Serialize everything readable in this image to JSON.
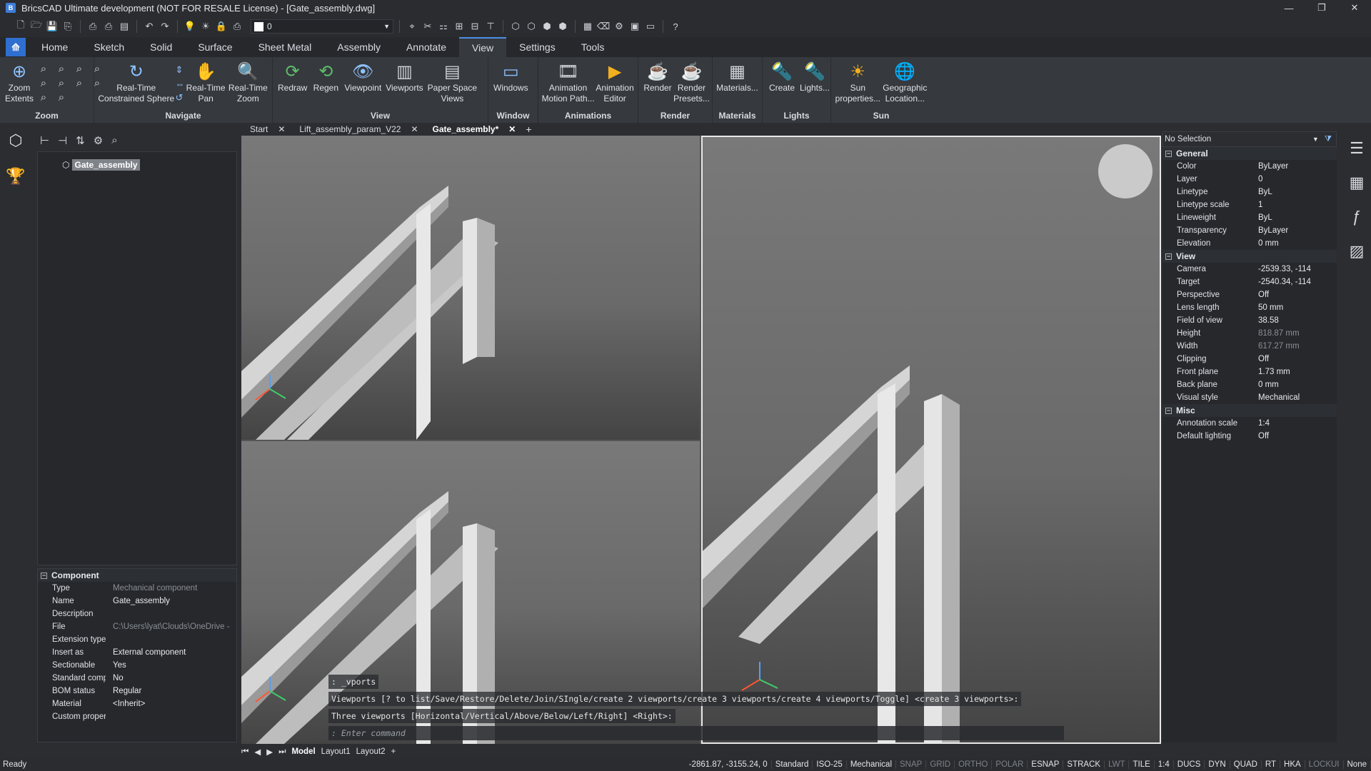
{
  "window": {
    "title": "BricsCAD Ultimate development (NOT FOR RESALE License) - [Gate_assembly.dwg]",
    "minimize": "—",
    "maximize": "❐",
    "close": "✕",
    "app_icon": "B"
  },
  "qat": {
    "layer_value": "0"
  },
  "ribbon_tabs": [
    "Home",
    "Sketch",
    "Solid",
    "Surface",
    "Sheet Metal",
    "Assembly",
    "Annotate",
    "View",
    "Settings",
    "Tools"
  ],
  "ribbon": {
    "zoom": {
      "label": "Zoom",
      "extents": "Zoom\nExtents"
    },
    "navigate": {
      "label": "Navigate",
      "sphere": "Real-Time\nConstrained Sphere",
      "pan": "Real-Time\nPan",
      "zoom": "Real-Time\nZoom"
    },
    "view": {
      "label": "View",
      "redraw": "Redraw",
      "regen": "Regen",
      "viewpoint": "Viewpoint",
      "viewports": "Viewports",
      "paper": "Paper Space\nViews"
    },
    "window": {
      "label": "Window",
      "windows": "Windows"
    },
    "animations": {
      "label": "Animations",
      "motion": "Animation\nMotion Path...",
      "editor": "Animation\nEditor"
    },
    "render": {
      "label": "Render",
      "render": "Render",
      "presets": "Render\nPresets..."
    },
    "materials": {
      "label": "Materials",
      "materials": "Materials..."
    },
    "lights": {
      "label": "Lights",
      "create": "Create",
      "lights": "Lights..."
    },
    "sun": {
      "label": "Sun",
      "props": "Sun\nproperties...",
      "geo": "Geographic\nLocation..."
    }
  },
  "browser": {
    "root": "Gate_assembly"
  },
  "component": {
    "header": "Component",
    "rows": [
      {
        "k": "Type",
        "v": "Mechanical component",
        "dim": true
      },
      {
        "k": "Name",
        "v": "Gate_assembly"
      },
      {
        "k": "Description",
        "v": ""
      },
      {
        "k": "File",
        "v": "C:\\Users\\lyat\\Clouds\\OneDrive -",
        "dim": true
      },
      {
        "k": "Extension type",
        "v": ""
      },
      {
        "k": "Insert as",
        "v": "External component"
      },
      {
        "k": "Sectionable",
        "v": "Yes"
      },
      {
        "k": "Standard compone",
        "v": "No"
      },
      {
        "k": "BOM status",
        "v": "Regular"
      },
      {
        "k": "Material",
        "v": "<Inherit>"
      },
      {
        "k": "Custom properties",
        "v": ""
      }
    ]
  },
  "doc_tabs": [
    "Start",
    "Lift_assembly_param_V22",
    "Gate_assembly*"
  ],
  "command": {
    "line1": ": _vports",
    "line2": "Viewports [? to list/Save/Restore/Delete/Join/SIngle/create 2 viewports/create 3 viewports/create 4 viewports/Toggle] <create 3 viewports>:",
    "line3": "Three viewports [Horizontal/Vertical/Above/Below/Left/Right] <Right>:",
    "placeholder": ": Enter command"
  },
  "layout_tabs": [
    "Model",
    "Layout1",
    "Layout2"
  ],
  "properties": {
    "selection": "No Selection",
    "sections": [
      {
        "title": "General",
        "rows": [
          {
            "k": "Color",
            "v": "ByLayer"
          },
          {
            "k": "Layer",
            "v": "0"
          },
          {
            "k": "Linetype",
            "v": "ByL"
          },
          {
            "k": "Linetype scale",
            "v": "1"
          },
          {
            "k": "Lineweight",
            "v": "ByL"
          },
          {
            "k": "Transparency",
            "v": "ByLayer"
          },
          {
            "k": "Elevation",
            "v": "0 mm"
          }
        ]
      },
      {
        "title": "View",
        "rows": [
          {
            "k": "Camera",
            "v": "-2539.33, -114"
          },
          {
            "k": "Target",
            "v": "-2540.34, -114"
          },
          {
            "k": "Perspective",
            "v": "Off"
          },
          {
            "k": "Lens length",
            "v": "50 mm"
          },
          {
            "k": "Field of view",
            "v": "38.58"
          },
          {
            "k": "Height",
            "v": "818.87 mm",
            "dim": true
          },
          {
            "k": "Width",
            "v": "617.27 mm",
            "dim": true
          },
          {
            "k": "Clipping",
            "v": "Off"
          },
          {
            "k": "Front plane",
            "v": "1.73 mm"
          },
          {
            "k": "Back plane",
            "v": "0 mm"
          },
          {
            "k": "Visual style",
            "v": "Mechanical"
          }
        ]
      },
      {
        "title": "Misc",
        "rows": [
          {
            "k": "Annotation scale",
            "v": "1:4"
          },
          {
            "k": "Default lighting",
            "v": "Off"
          }
        ]
      }
    ]
  },
  "status": {
    "ready": "Ready",
    "coords": "-2861.87, -3155.24, 0",
    "items": [
      "Standard",
      "ISO-25",
      "Mechanical",
      "SNAP",
      "GRID",
      "ORTHO",
      "POLAR",
      "ESNAP",
      "STRACK",
      "LWT",
      "TILE",
      "1:4",
      "DUCS",
      "DYN",
      "QUAD",
      "RT",
      "HKA",
      "LOCKUI",
      "None"
    ],
    "off_items": [
      "SNAP",
      "GRID",
      "ORTHO",
      "POLAR",
      "LWT",
      "LOCKUI"
    ]
  }
}
